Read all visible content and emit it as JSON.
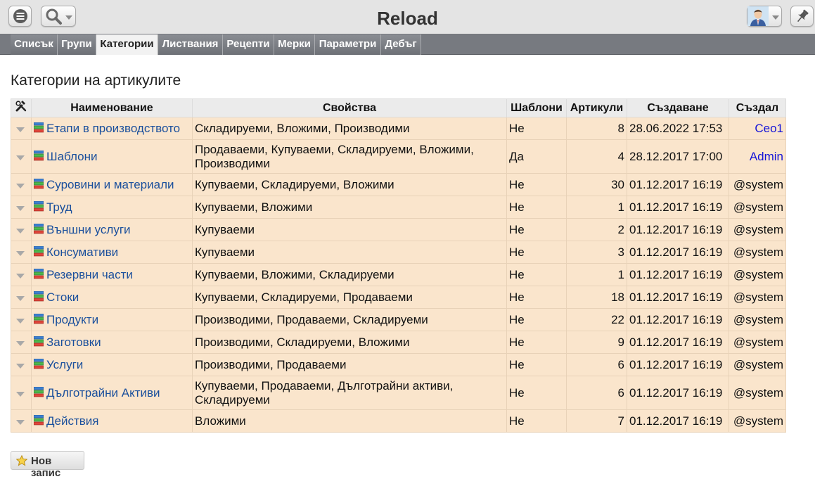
{
  "app": {
    "title": "Reload"
  },
  "tabs": [
    {
      "label": "Списък",
      "active": false
    },
    {
      "label": "Групи",
      "active": false
    },
    {
      "label": "Категории",
      "active": true
    },
    {
      "label": "Листвания",
      "active": false
    },
    {
      "label": "Рецепти",
      "active": false
    },
    {
      "label": "Мерки",
      "active": false
    },
    {
      "label": "Параметри",
      "active": false
    },
    {
      "label": "Дебъг",
      "active": false
    }
  ],
  "page": {
    "heading": "Категории на артикулите"
  },
  "table": {
    "columns": [
      "Наименование",
      "Свойства",
      "Шаблони",
      "Артикули",
      "Създаване",
      "Създал"
    ],
    "rows": [
      {
        "name": "Етапи в производството",
        "props": "Складируеми, Вложими, Производими",
        "template": "Не",
        "count": "8",
        "created": "28.06.2022 17:53",
        "creator": "Ceo1"
      },
      {
        "name": "Шаблони",
        "props": "Продаваеми, Купуваеми, Складируеми, Вложими, Производими",
        "template": "Да",
        "count": "4",
        "created": "28.12.2017 17:00",
        "creator": "Admin"
      },
      {
        "name": "Суровини и материали",
        "props": "Купуваеми, Складируеми, Вложими",
        "template": "Не",
        "count": "30",
        "created": "01.12.2017 16:19",
        "creator": "@system"
      },
      {
        "name": "Труд",
        "props": "Купуваеми, Вложими",
        "template": "Не",
        "count": "1",
        "created": "01.12.2017 16:19",
        "creator": "@system"
      },
      {
        "name": "Външни услуги",
        "props": "Купуваеми",
        "template": "Не",
        "count": "2",
        "created": "01.12.2017 16:19",
        "creator": "@system"
      },
      {
        "name": "Консумативи",
        "props": "Купуваеми",
        "template": "Не",
        "count": "3",
        "created": "01.12.2017 16:19",
        "creator": "@system"
      },
      {
        "name": "Резервни части",
        "props": "Купуваеми, Вложими, Складируеми",
        "template": "Не",
        "count": "1",
        "created": "01.12.2017 16:19",
        "creator": "@system"
      },
      {
        "name": "Стоки",
        "props": "Купуваеми, Складируеми, Продаваеми",
        "template": "Не",
        "count": "18",
        "created": "01.12.2017 16:19",
        "creator": "@system"
      },
      {
        "name": "Продукти",
        "props": "Производими, Продаваеми, Складируеми",
        "template": "Не",
        "count": "22",
        "created": "01.12.2017 16:19",
        "creator": "@system"
      },
      {
        "name": "Заготовки",
        "props": "Производими, Складируеми, Вложими",
        "template": "Не",
        "count": "9",
        "created": "01.12.2017 16:19",
        "creator": "@system"
      },
      {
        "name": "Услуги",
        "props": "Производими, Продаваеми",
        "template": "Не",
        "count": "6",
        "created": "01.12.2017 16:19",
        "creator": "@system"
      },
      {
        "name": "Дълготрайни Активи",
        "props": "Купуваеми, Продаваеми, Дълготрайни активи, Складируеми",
        "template": "Не",
        "count": "6",
        "created": "01.12.2017 16:19",
        "creator": "@system"
      },
      {
        "name": "Действия",
        "props": "Вложими",
        "template": "Не",
        "count": "7",
        "created": "01.12.2017 16:19",
        "creator": "@system"
      }
    ]
  },
  "actions": {
    "new_record": "Нов запис"
  },
  "icons": {
    "menu": "hamburger-menu-icon",
    "search": "magnifier-icon",
    "user": "user-avatar-icon",
    "pin": "pushpin-icon",
    "tools": "tools-icon",
    "category": "category-stack-icon",
    "new": "star-icon"
  },
  "colors": {
    "row_bg": "#fae5cc",
    "header_bg": "#ebebeb",
    "tabbar_bg": "#777a80",
    "link": "#1a4f9c",
    "creator_link": "#1414d8"
  }
}
